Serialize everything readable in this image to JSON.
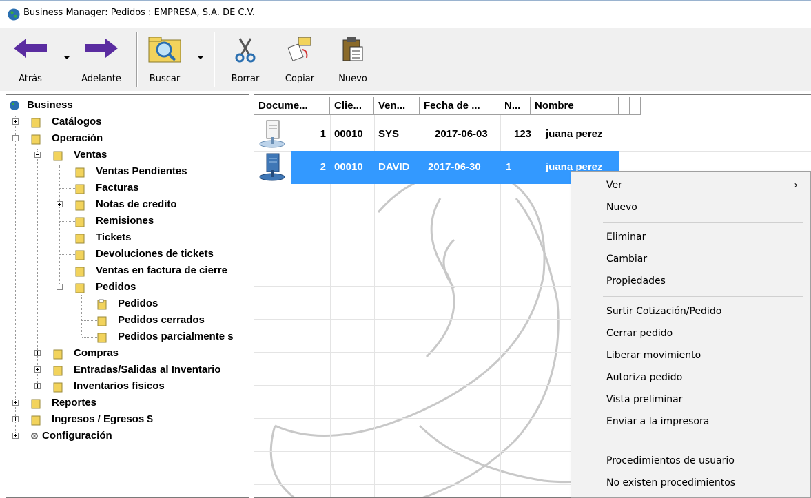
{
  "window": {
    "title": "Business Manager: Pedidos : EMPRESA, S.A. DE C.V."
  },
  "toolbar": {
    "back": "Atrás",
    "forward": "Adelante",
    "search": "Buscar",
    "delete": "Borrar",
    "copy": "Copiar",
    "new": "Nuevo"
  },
  "tree": {
    "root": "Business",
    "catalogos": "Catálogos",
    "operacion": "Operación",
    "ventas": "Ventas",
    "ventas_pendientes": "Ventas Pendientes",
    "facturas": "Facturas",
    "notas_credito": "Notas de credito",
    "remisiones": "Remisiones",
    "tickets": "Tickets",
    "devoluciones": "Devoluciones de tickets",
    "ventas_cierre": "Ventas en factura de cierre",
    "pedidos_folder": "Pedidos",
    "pedidos": "Pedidos",
    "pedidos_cerrados": "Pedidos cerrados",
    "pedidos_parcial": "Pedidos parcialmente s",
    "compras": "Compras",
    "entradas_salidas": "Entradas/Salidas al Inventario",
    "inventarios_fisicos": "Inventarios físicos",
    "reportes": "Reportes",
    "ingresos_egresos": "Ingresos / Egresos $",
    "configuracion": "Configuración"
  },
  "list": {
    "columns": [
      "Docume...",
      "Clie...",
      "Ven...",
      "Fecha de ...",
      "N...",
      "Nombre"
    ],
    "rows": [
      {
        "doc": "1",
        "cliente": "00010",
        "vendedor": "SYS",
        "fecha": "2017-06-03",
        "n": "123",
        "nombre": "juana perez"
      },
      {
        "doc": "2",
        "cliente": "00010",
        "vendedor": "DAVID",
        "fecha": "2017-06-30",
        "n": "1",
        "nombre": "juana perez"
      }
    ]
  },
  "context_menu": {
    "ver": "Ver",
    "ver_arrow": "›",
    "nuevo": "Nuevo",
    "eliminar": "Eliminar",
    "cambiar": "Cambiar",
    "propiedades": "Propiedades",
    "surtir": "Surtir Cotización/Pedido",
    "cerrar": "Cerrar pedido",
    "liberar": "Liberar movimiento",
    "autoriza": "Autoriza pedido",
    "vista": "Vista preliminar",
    "enviar": "Enviar a la impresora",
    "procedimientos": "Procedimientos de usuario",
    "no_procedimientos": "No existen procedimientos"
  },
  "colors": {
    "selection": "#3399ff",
    "menu_bg": "#f2f2f2",
    "toolbar_bg": "#f0f0f0",
    "arrow": "#5a2ca0",
    "folder": "#f2d35c"
  }
}
